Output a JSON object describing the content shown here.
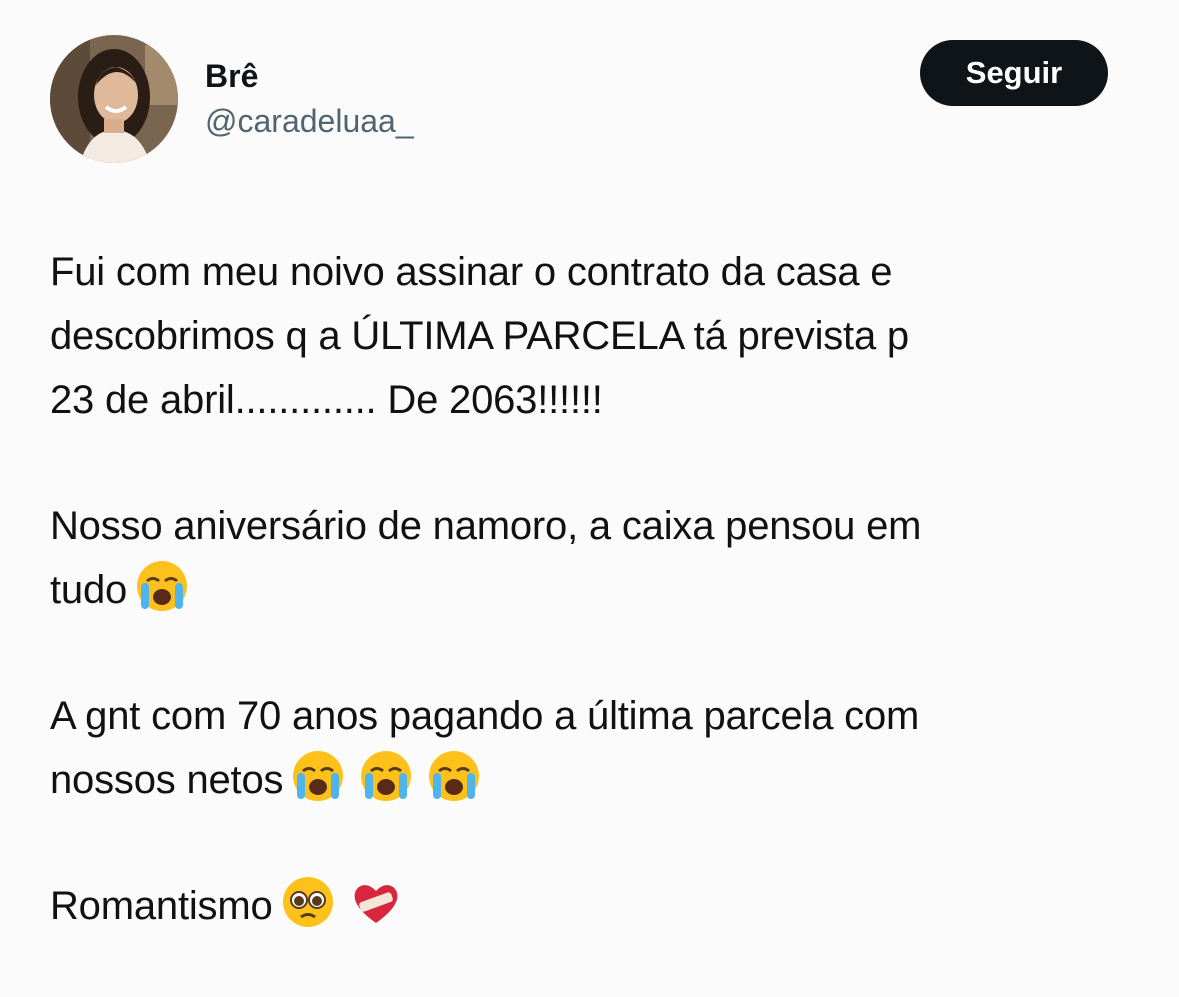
{
  "user": {
    "display_name": "Brê",
    "handle": "@caradeluaa_"
  },
  "follow_button": {
    "label": "Seguir"
  },
  "tweet": {
    "paragraph1": {
      "line1": "Fui com meu noivo assinar o contrato da casa e",
      "line2": "descobrimos q a ÚLTIMA PARCELA tá prevista p",
      "line3": "23 de abril............. De 2063!!!!!!"
    },
    "paragraph2": {
      "line1": "Nosso aniversário de namoro, a caixa pensou em",
      "line2": "tudo"
    },
    "paragraph3": {
      "line1": "A gnt com 70 anos pagando a última parcela com",
      "line2": "nossos netos"
    },
    "paragraph4": {
      "line1": "Romantismo"
    }
  },
  "icons": {
    "avatar": "avatar-photo",
    "crying": "loudly-crying-face-emoji",
    "pleading": "pleading-face-emoji",
    "heart": "mending-heart-emoji"
  },
  "colors": {
    "background": "#fbfbfb",
    "text": "#111111",
    "handle": "#536471",
    "button_bg": "#0f1419",
    "button_text": "#ffffff"
  }
}
